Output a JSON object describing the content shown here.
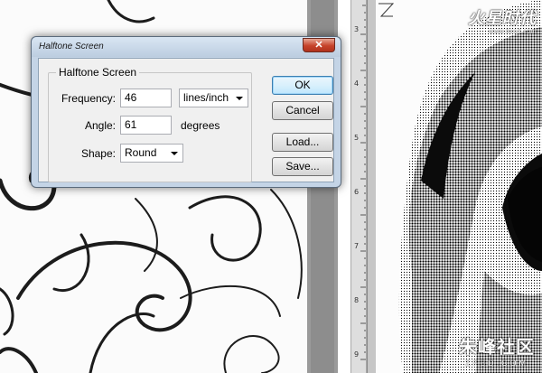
{
  "dialog": {
    "title": "Halftone Screen",
    "close_label": "✕",
    "group_label": "Halftone Screen",
    "frequency": {
      "label": "Frequency:",
      "value": "46",
      "unit": "lines/inch"
    },
    "angle": {
      "label": "Angle:",
      "value": "61",
      "unit": "degrees"
    },
    "shape": {
      "label": "Shape:",
      "value": "Round"
    },
    "buttons": {
      "ok": "OK",
      "cancel": "Cancel",
      "load": "Load...",
      "save": "Save..."
    }
  },
  "ruler": {
    "numbers": [
      "3",
      "4",
      "5",
      "6",
      "7",
      "8",
      "9"
    ]
  },
  "watermarks": {
    "top_main": "火星时代",
    "top_sub": "www.hxsd.com",
    "bottom_main": "朱峰社区",
    "bottom_sub": "ZF3D.COM"
  },
  "colors": {
    "dialog_frame": "#c4d4e6",
    "close_red": "#c6432b",
    "default_button": "#bee6fd"
  },
  "icons": {
    "close": "close-icon",
    "dropdown": "chevron-down-icon"
  }
}
